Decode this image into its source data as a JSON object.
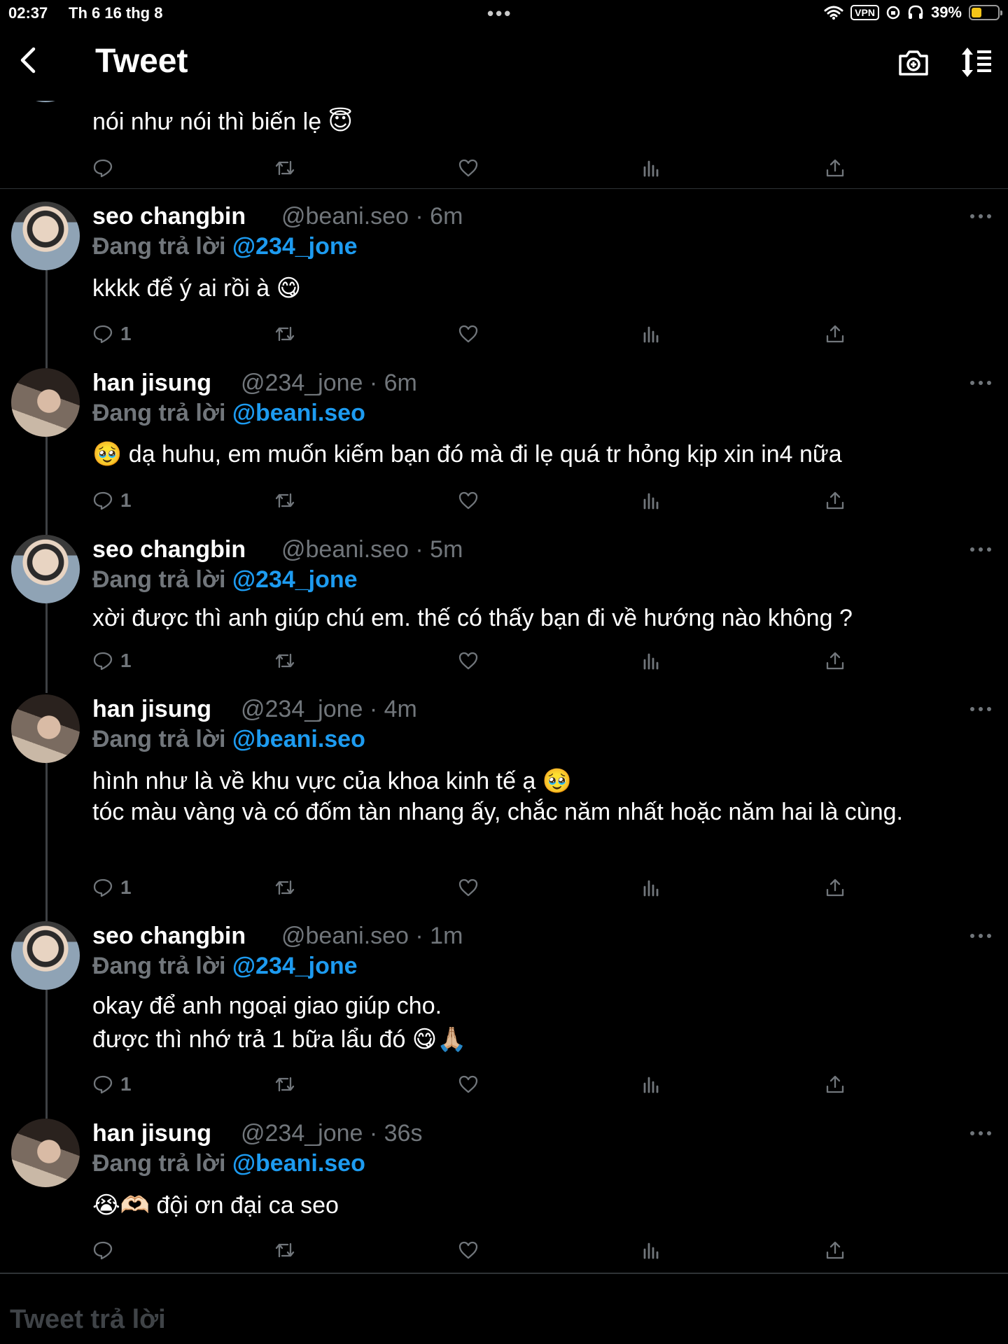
{
  "status_bar": {
    "time": "02:37",
    "date": "Th 6 16 thg 8",
    "vpn": "VPN",
    "battery": "39%",
    "battery_level": 0.39
  },
  "nav": {
    "title": "Tweet"
  },
  "colors": {
    "mention": "#1d9bf0",
    "muted": "#71767b",
    "battery": "#f5c518"
  },
  "top_tweet": {
    "text": "nói như nói thì biến lẹ 😇"
  },
  "tweets": [
    {
      "name": "seo changbin",
      "meta": "@beani.seo · 6m",
      "reply_prefix": "Đang trả lời",
      "reply_to": "@234_jone",
      "text": "kkkk để ý ai rồi à 😋",
      "reply_count": "1"
    },
    {
      "name": "han jisung",
      "meta": "@234_jone · 6m",
      "reply_prefix": "Đang trả lời",
      "reply_to": "@beani.seo",
      "text": "🥹 dạ huhu, em muốn kiếm bạn đó mà đi lẹ quá tr hỏng kịp xin in4 nữa",
      "reply_count": "1"
    },
    {
      "name": "seo changbin",
      "meta": "@beani.seo · 5m",
      "reply_prefix": "Đang trả lời",
      "reply_to": "@234_jone",
      "text": "xời được thì anh giúp chú em. thế có thấy bạn đi về hướng nào không ?",
      "reply_count": "1"
    },
    {
      "name": "han jisung",
      "meta": "@234_jone · 4m",
      "reply_prefix": "Đang trả lời",
      "reply_to": "@beani.seo",
      "text": "hình như là về khu vực của khoa kinh tế ạ 🥹\ntóc màu vàng và có đốm tàn nhang ấy, chắc năm nhất hoặc năm hai là cùng.",
      "reply_count": "1"
    },
    {
      "name": "seo changbin",
      "meta": "@beani.seo · 1m",
      "reply_prefix": "Đang trả lời",
      "reply_to": "@234_jone",
      "text": "okay để anh ngoại giao giúp cho.\nđược thì nhớ trả 1 bữa lẩu đó 😋🙏🏼",
      "reply_count": "1"
    },
    {
      "name": "han jisung",
      "meta": "@234_jone · 36s",
      "reply_prefix": "Đang trả lời",
      "reply_to": "@beani.seo",
      "text": "😭🫶🏻 đội ơn đại ca seo",
      "reply_count": ""
    }
  ],
  "reply_box": {
    "placeholder": "Tweet trả lời"
  }
}
